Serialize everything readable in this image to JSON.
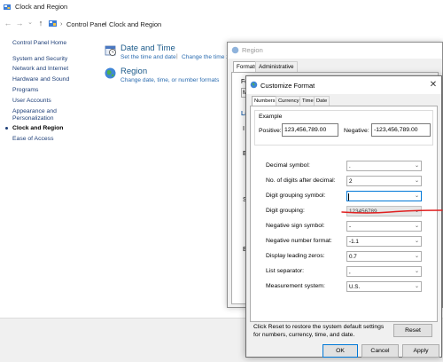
{
  "control_panel": {
    "window_title": "Clock and Region",
    "breadcrumb": [
      "Control Panel",
      "Clock and Region"
    ],
    "left_nav": [
      {
        "label": "Control Panel Home",
        "current": false
      },
      {
        "label": "System and Security",
        "current": false
      },
      {
        "label": "Network and Internet",
        "current": false
      },
      {
        "label": "Hardware and Sound",
        "current": false
      },
      {
        "label": "Programs",
        "current": false
      },
      {
        "label": "User Accounts",
        "current": false
      },
      {
        "label": "Appearance and",
        "current": false
      },
      {
        "label": "Personalization",
        "current": false
      },
      {
        "label": "Clock and Region",
        "current": true
      },
      {
        "label": "Ease of Access",
        "current": false
      }
    ],
    "categories": [
      {
        "title": "Date and Time",
        "links": [
          "Set the time and date",
          "Change the time zo"
        ]
      },
      {
        "title": "Region",
        "links": [
          "Change date, time, or number formats"
        ]
      }
    ]
  },
  "region_dialog": {
    "title": "Region",
    "tabs": [
      "Formats",
      "Administrative"
    ],
    "glimpse": [
      "Fo",
      "M",
      "La"
    ]
  },
  "customize_format": {
    "title": "Customize Format",
    "close_glyph": "✕",
    "tabs": [
      "Numbers",
      "Currency",
      "Time",
      "Date"
    ],
    "example": {
      "heading": "Example",
      "positive_label": "Positive:",
      "positive_value": "123,456,789.00",
      "negative_label": "Negative:",
      "negative_value": "-123,456,789.00"
    },
    "settings": [
      {
        "label": "Decimal symbol:",
        "value": ".",
        "state": "normal"
      },
      {
        "label": "No. of digits after decimal:",
        "value": "2",
        "state": "normal"
      },
      {
        "label": "Digit grouping symbol:",
        "value": "",
        "state": "focused"
      },
      {
        "label": "Digit grouping:",
        "value": "123456789",
        "state": "disabled"
      },
      {
        "label": "Negative sign symbol:",
        "value": "-",
        "state": "normal"
      },
      {
        "label": "Negative number format:",
        "value": "-1.1",
        "state": "normal"
      },
      {
        "label": "Display leading zeros:",
        "value": "0.7",
        "state": "normal"
      },
      {
        "label": "List separator:",
        "value": ",",
        "state": "normal"
      },
      {
        "label": "Measurement system:",
        "value": "U.S.",
        "state": "normal"
      }
    ],
    "dropdown_glyph": "⌄",
    "reset_text": "Click Reset to restore the system default settings for numbers, currency, time, and date.",
    "buttons": {
      "reset": "Reset",
      "ok": "OK",
      "cancel": "Cancel",
      "apply": "Apply"
    }
  },
  "colors": {
    "link": "#2b6cb0",
    "category_title": "#1b5a8a",
    "annotation_red": "#e02020",
    "focus_border": "#0078d7"
  }
}
